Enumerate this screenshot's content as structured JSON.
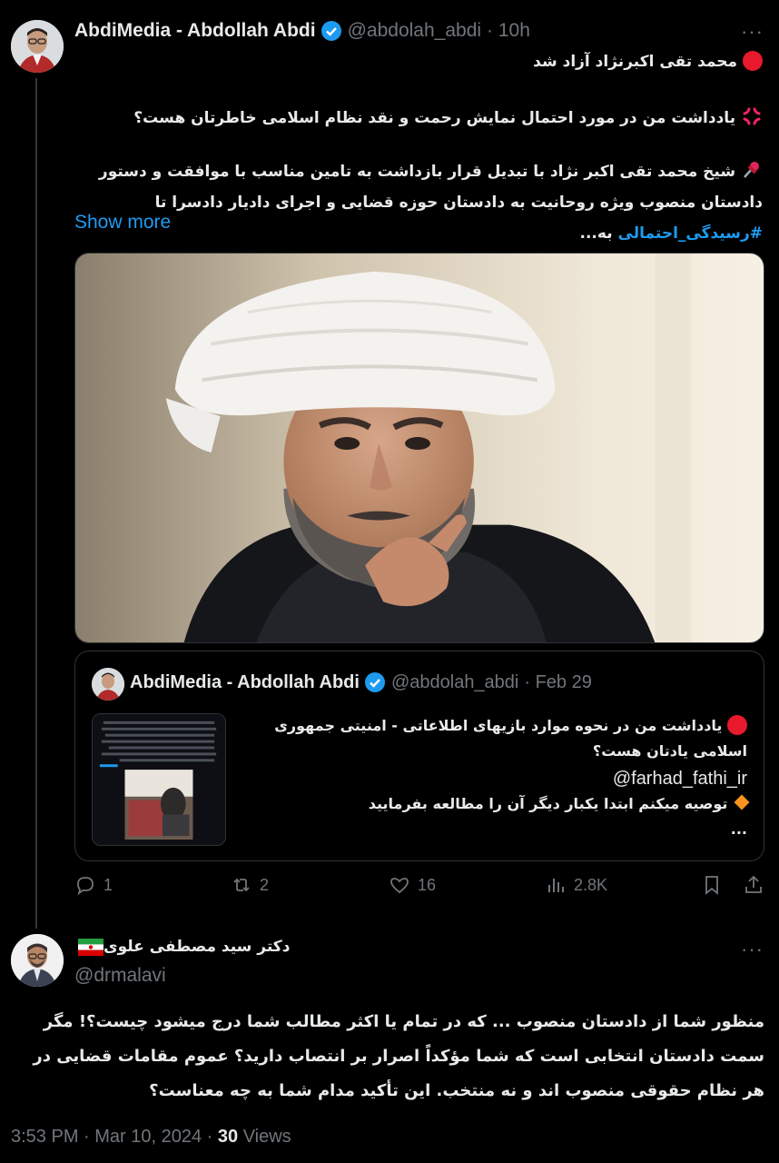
{
  "tweet": {
    "author": {
      "name": "AbdiMedia - Abdollah Abdi",
      "handle": "@abdolah_abdi",
      "time": "· 10h"
    },
    "more_label": "···",
    "line1": "محمد تقی اکبرنژاد آزاد شد",
    "line2": "یادداشت من در مورد احتمال نمایش رحمت و نقد نظام اسلامی خاطرتان هست؟",
    "para_text": "شیخ محمد تقی اکبر نژاد با تبدیل قرار بازداشت به تامین مناسب با موافقت و دستور دادستان منصوب ویژه روحانیت به دادستان حوزه قضایی و اجرای دادیار دادسرا تا ",
    "hashtag": "#رسیدگی_احتمالی",
    "para_tail": " به...",
    "show_more": "Show more",
    "quote": {
      "name": "AbdiMedia - Abdollah Abdi",
      "handle": "@abdolah_abdi",
      "date": "· Feb 29",
      "line1": "یادداشت من در نحوه موارد بازیهای اطلاعاتی - امنیتی جمهوری اسلامی یادتان هست؟",
      "mention": "@farhad_fathi_ir",
      "line3": "توصیه میکنم ابتدا یکبار دیگر آن را مطالعه بفرمایید",
      "ellipsis": "..."
    },
    "actions": {
      "replies": "1",
      "reposts": "2",
      "likes": "16",
      "views": "2.8K"
    }
  },
  "reply": {
    "name": "دکتر سید مصطفی علوی",
    "handle": "@drmalavi",
    "more_label": "···",
    "body": "منظور شما از دادستان منصوب ... که در تمام یا اکثر مطالب شما درج میشود چیست؟! مگر سمت دادستان انتخابی است که شما مؤکداً اصرار بر انتصاب دارید؟ عموم مقامات قضایی در هر نظام حقوقی منصوب اند و نه منتخب. این تأکید مدام شما به چه معناست؟",
    "time": "3:53 PM · Mar 10, 2024 · ",
    "views_count": "30",
    "views_label": " Views"
  },
  "colors": {
    "background": "#000000",
    "text": "#e7e9ea",
    "muted": "#71767b",
    "link": "#1d9bf0",
    "verified": "#1d9bf0",
    "divider": "#2f3336"
  },
  "icons": [
    "verified-badge-icon",
    "more-icon",
    "reply-icon",
    "repost-icon",
    "like-icon",
    "views-icon",
    "bookmark-icon",
    "share-icon",
    "red-circle-icon",
    "anger-icon",
    "pushpin-icon",
    "orange-diamond-icon",
    "iran-flag-icon"
  ]
}
